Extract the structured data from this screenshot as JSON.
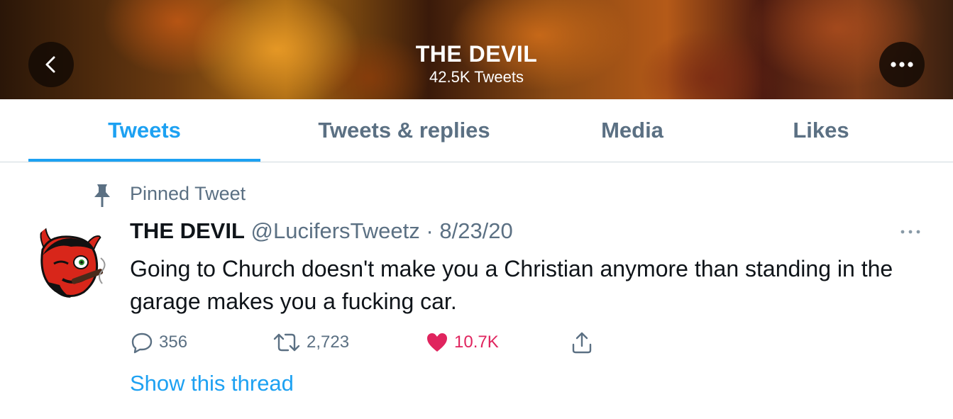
{
  "header": {
    "title": "THE DEVIL",
    "tweet_count": "42.5K Tweets"
  },
  "tabs": [
    {
      "label": "Tweets",
      "active": true
    },
    {
      "label": "Tweets & replies",
      "active": false
    },
    {
      "label": "Media",
      "active": false
    },
    {
      "label": "Likes",
      "active": false
    }
  ],
  "tweet": {
    "pinned_label": "Pinned Tweet",
    "author_name": "THE DEVIL",
    "handle": "@LucifersTweetz",
    "separator": "·",
    "date": "8/23/20",
    "text": "Going to Church doesn't make you a Christian anymore than standing in the garage makes you a fucking car.",
    "replies": "356",
    "retweets": "2,723",
    "likes": "10.7K",
    "show_thread": "Show this thread"
  },
  "colors": {
    "accent": "#1da1f2",
    "like": "#e0245e",
    "muted": "#5b7083",
    "text": "#0f1419"
  },
  "icons": [
    "back-arrow-icon",
    "more-options-icon",
    "pin-icon",
    "reply-icon",
    "retweet-icon",
    "heart-icon",
    "share-icon",
    "more-horizontal-icon"
  ]
}
